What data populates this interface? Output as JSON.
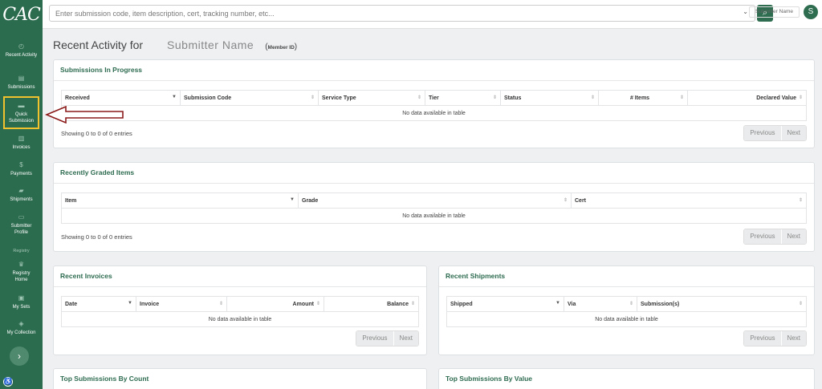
{
  "app": {
    "logo": "CAC"
  },
  "sidebar": {
    "items": [
      {
        "label": "Recent Activity",
        "icon": "history-icon"
      },
      {
        "label": "Submissions",
        "icon": "file-icon"
      },
      {
        "label": "Quick Submission",
        "icon": "folder-icon"
      },
      {
        "label": "Invoices",
        "icon": "invoice-icon"
      },
      {
        "label": "Payments",
        "icon": "dollar-icon"
      },
      {
        "label": "Shipments",
        "icon": "truck-icon"
      },
      {
        "label": "Submitter Profile",
        "icon": "id-card-icon"
      }
    ],
    "registry_heading": "Registry",
    "registry_items": [
      {
        "label": "Registry Home",
        "icon": "trophy-icon"
      },
      {
        "label": "My Sets",
        "icon": "box-icon"
      },
      {
        "label": "My Collection",
        "icon": "layers-icon"
      }
    ],
    "highlight_color": "#f2c12e"
  },
  "topbar": {
    "search_placeholder": "Enter submission code, item description, cert, tracking number, etc...",
    "submitter_label": "Submitter Name",
    "avatar_initial": "S"
  },
  "page": {
    "title": "Recent Activity for",
    "submitter_name": "Submitter  Name",
    "member_id_open": "(",
    "member_id": "Member ID",
    "member_id_close": ")"
  },
  "submissions_in_progress": {
    "title": "Submissions In Progress",
    "columns": [
      "Received",
      "Submission Code",
      "Service Type",
      "Tier",
      "Status",
      "# Items",
      "Declared Value"
    ],
    "empty": "No data available in table",
    "showing": "Showing 0 to 0 of 0 entries",
    "prev": "Previous",
    "next": "Next"
  },
  "recently_graded": {
    "title": "Recently Graded Items",
    "columns": [
      "Item",
      "Grade",
      "Cert"
    ],
    "empty": "No data available in table",
    "showing": "Showing 0 to 0 of 0 entries",
    "prev": "Previous",
    "next": "Next"
  },
  "recent_invoices": {
    "title": "Recent Invoices",
    "columns": [
      "Date",
      "Invoice",
      "Amount",
      "Balance"
    ],
    "empty": "No data available in table",
    "prev": "Previous",
    "next": "Next"
  },
  "recent_shipments": {
    "title": "Recent Shipments",
    "columns": [
      "Shipped",
      "Via",
      "Submission(s)"
    ],
    "empty": "No data available in table",
    "prev": "Previous",
    "next": "Next"
  },
  "top_by_count": {
    "title": "Top Submissions By Count"
  },
  "top_by_value": {
    "title": "Top Submissions By Value"
  },
  "annotation": {
    "arrow_color": "#8b1a1a"
  }
}
